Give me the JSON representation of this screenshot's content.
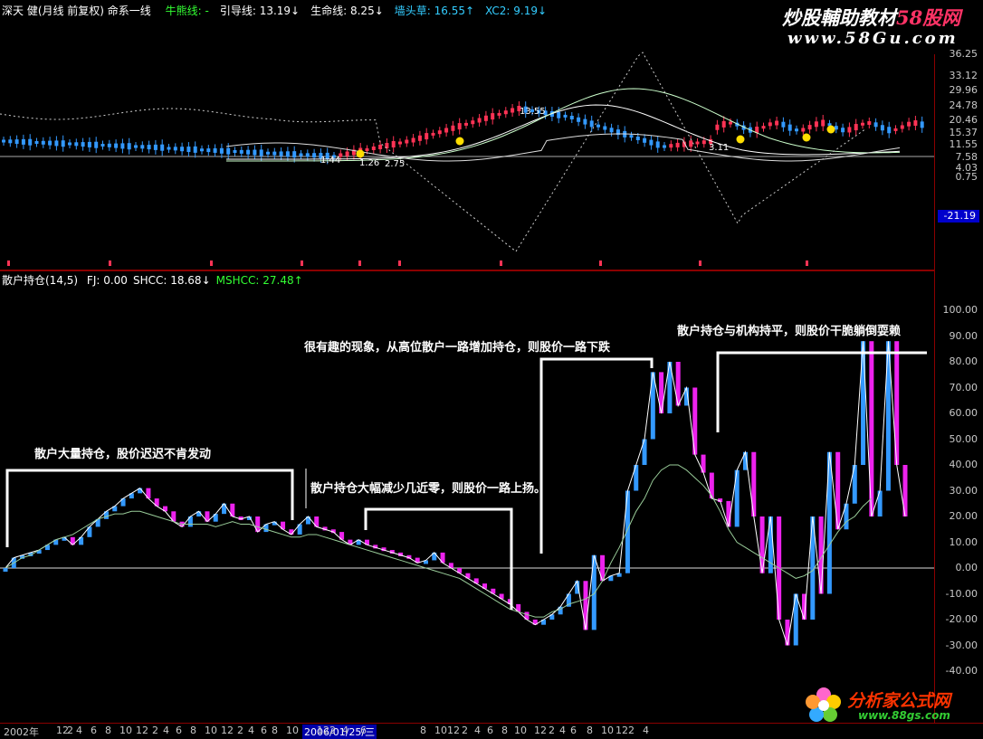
{
  "top_header": {
    "stock": "深天 健(月线 前复权) 命系一线",
    "items": [
      {
        "label": "牛熊线: -",
        "color": "#33ff33"
      },
      {
        "label": "引导线: 13.19↓",
        "color": "#ffffff"
      },
      {
        "label": "生命线: 8.25↓",
        "color": "#ffffff"
      },
      {
        "label": "墙头草: 16.55↑",
        "color": "#33ccff"
      },
      {
        "label": "XC2: 9.19↓",
        "color": "#33ccff"
      }
    ]
  },
  "bottom_header": {
    "name": "散户持仓(14,5)",
    "items": [
      {
        "label": "FJ: 0.00",
        "color": "#ffffff"
      },
      {
        "label": "SHCC: 18.68↓",
        "color": "#ffffff"
      },
      {
        "label": "MSHCC: 27.48↑",
        "color": "#33ff33"
      }
    ]
  },
  "watermarks": {
    "top_line1": "炒股輔助教材",
    "top_brand": "58股网",
    "top_url": "www.58Gu.com",
    "bottom_brand": "分析家公式网",
    "bottom_url": "www.88gs.com"
  },
  "annotations": [
    {
      "text": "散户大量持仓，股价迟迟不肯发动"
    },
    {
      "text": "散户持仓大幅减少几近零，则股价一路上扬。"
    },
    {
      "text": "很有趣的现象，从高位散户一路增加持仓，则股价一路下跌"
    },
    {
      "text": "散户持仓与机构持平，则股价干脆躺倒耍赖"
    }
  ],
  "price_labels": [
    "13.55",
    "1.44",
    "1.26",
    "2.75",
    "3.11"
  ],
  "colors": {
    "up": "#ff3355",
    "down": "#3399ff",
    "magenta": "#ee22ee",
    "border": "#8b0000"
  },
  "chart_data": [
    {
      "type": "candlestick",
      "y_ticks": [
        36.25,
        33.12,
        29.96,
        24.78,
        20.46,
        15.37,
        11.55,
        7.58,
        4.03,
        0.75
      ],
      "value_marker": -21.19,
      "xlabel": "",
      "ylabel": "",
      "series": [
        {
          "name": "牛熊线"
        },
        {
          "name": "引导线",
          "last": 13.19
        },
        {
          "name": "生命线",
          "last": 8.25
        },
        {
          "name": "墙头草",
          "last": 16.55
        },
        {
          "name": "XC2",
          "last": 9.19
        }
      ]
    },
    {
      "type": "bar",
      "ylim": [
        -50,
        110
      ],
      "y_ticks": [
        100,
        90,
        80,
        70,
        60,
        50,
        40,
        30,
        20,
        10,
        0,
        -10,
        -20,
        -30,
        -40
      ],
      "x_ticks": [
        "2002年",
        "12",
        "2",
        "4",
        "6",
        "8",
        "10",
        "12",
        "2",
        "4",
        "6",
        "8",
        "10",
        "12",
        "2",
        "4",
        "6",
        "8",
        "10",
        "2006/01/25/三",
        "12",
        "2",
        "4",
        "6",
        "8",
        "10",
        "12",
        "2",
        "4",
        "6",
        "8",
        "10",
        "12",
        "2",
        "4",
        "6",
        "8",
        "10",
        "12",
        "2",
        "4"
      ],
      "SHCC": [
        0,
        4,
        5,
        6,
        7,
        9,
        11,
        12,
        9,
        12,
        16,
        19,
        22,
        24,
        27,
        29,
        31,
        27,
        24,
        22,
        18,
        16,
        20,
        22,
        18,
        21,
        25,
        20,
        19,
        20,
        14,
        17,
        18,
        15,
        13,
        17,
        20,
        16,
        15,
        14,
        11,
        9,
        11,
        9,
        8,
        7,
        6,
        5,
        4,
        2,
        3,
        6,
        2,
        0,
        -2,
        -4,
        -6,
        -8,
        -10,
        -12,
        -14,
        -17,
        -20,
        -22,
        -20,
        -18,
        -15,
        -10,
        -5,
        -24,
        5,
        -5,
        -3,
        -2,
        30,
        40,
        50,
        76,
        60,
        80,
        63,
        70,
        44,
        37,
        27,
        26,
        16,
        38,
        45,
        20,
        -2,
        20,
        -20,
        -30,
        -10,
        -20,
        20,
        -10,
        45,
        15,
        25,
        40,
        88,
        20,
        30,
        88,
        40,
        20
      ],
      "MSHCC": [
        0,
        2,
        4,
        5,
        7,
        9,
        11,
        12,
        13,
        15,
        17,
        19,
        20,
        21,
        21,
        22,
        22,
        21,
        20,
        19,
        18,
        17,
        17,
        17,
        17,
        16,
        17,
        18,
        17,
        17,
        16,
        15,
        14,
        13,
        12,
        12,
        13,
        13,
        12,
        11,
        10,
        9,
        8,
        7,
        6,
        5,
        4,
        3,
        2,
        1,
        0,
        -1,
        -2,
        -3,
        -4,
        -6,
        -8,
        -10,
        -12,
        -14,
        -16,
        -17,
        -18,
        -19,
        -19,
        -17,
        -16,
        -14,
        -13,
        -12,
        -10,
        -5,
        2,
        8,
        15,
        22,
        27,
        34,
        38,
        40,
        40,
        38,
        35,
        32,
        28,
        22,
        15,
        10,
        8,
        6,
        4,
        2,
        0,
        -2,
        -4,
        -3,
        -1,
        4,
        9,
        14,
        18,
        20,
        24,
        27
      ],
      "series": [
        {
          "name": "SHCC"
        },
        {
          "name": "MSHCC"
        }
      ],
      "xlabel": "",
      "ylabel": ""
    }
  ]
}
